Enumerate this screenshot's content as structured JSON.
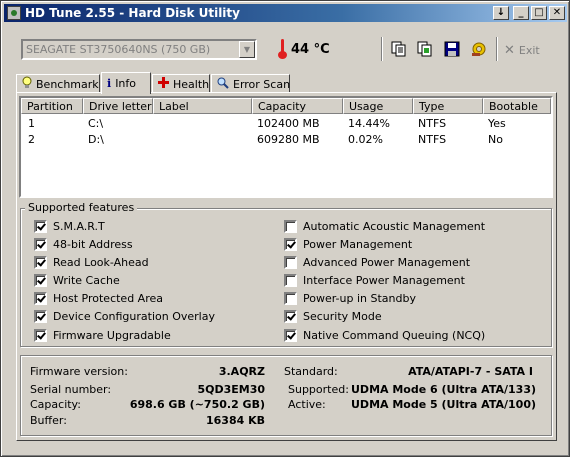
{
  "window": {
    "title": "HD Tune 2.55 - Hard Disk Utility",
    "minimize_glyph": "_",
    "restore_glyph": "□",
    "close_glyph": "✕",
    "arrow_glyph": "↓"
  },
  "toolbar": {
    "drive": "SEAGATE ST3750640NS (750 GB)",
    "temperature": "44 °C",
    "exit_label": "Exit",
    "icons": [
      "copy-info-icon",
      "copy-screenshot-icon",
      "save-icon",
      "options-icon",
      "exit-icon"
    ]
  },
  "tabs": [
    {
      "label": "Benchmark",
      "icon": "lightbulb-icon"
    },
    {
      "label": "Info",
      "icon": "info-icon",
      "active": true
    },
    {
      "label": "Health",
      "icon": "health-cross-icon"
    },
    {
      "label": "Error Scan",
      "icon": "magnifier-icon"
    }
  ],
  "partitions": {
    "columns": [
      "Partition",
      "Drive letter",
      "Label",
      "Capacity",
      "Usage",
      "Type",
      "Bootable"
    ],
    "rows": [
      [
        "1",
        "C:\\",
        "",
        "102400 MB",
        "14.44%",
        "NTFS",
        "Yes"
      ],
      [
        "2",
        "D:\\",
        "",
        "609280 MB",
        "0.02%",
        "NTFS",
        "No"
      ]
    ]
  },
  "features": {
    "title": "Supported features",
    "left": [
      {
        "label": "S.M.A.R.T",
        "checked": true
      },
      {
        "label": "48-bit Address",
        "checked": true
      },
      {
        "label": "Read Look-Ahead",
        "checked": true
      },
      {
        "label": "Write Cache",
        "checked": true
      },
      {
        "label": "Host Protected Area",
        "checked": true
      },
      {
        "label": "Device Configuration Overlay",
        "checked": true
      },
      {
        "label": "Firmware Upgradable",
        "checked": true
      }
    ],
    "right": [
      {
        "label": "Automatic Acoustic Management",
        "checked": false
      },
      {
        "label": "Power Management",
        "checked": true
      },
      {
        "label": "Advanced Power Management",
        "checked": false
      },
      {
        "label": "Interface Power Management",
        "checked": false
      },
      {
        "label": "Power-up in Standby",
        "checked": false
      },
      {
        "label": "Security Mode",
        "checked": true
      },
      {
        "label": "Native Command Queuing (NCQ)",
        "checked": true
      }
    ]
  },
  "details": {
    "firmware_label": "Firmware version:",
    "firmware": "3.AQRZ",
    "serial_label": "Serial number:",
    "serial": "5QD3EM30",
    "capacity_label": "Capacity:",
    "capacity": "698.6 GB (~750.2 GB)",
    "buffer_label": "Buffer:",
    "buffer": "16384 KB",
    "standard_label": "Standard:",
    "standard": "ATA/ATAPI-7 - SATA I",
    "supported_label": "Supported:",
    "supported": "UDMA Mode 6 (Ultra ATA/133)",
    "active_label": "Active:",
    "active": "UDMA Mode 5 (Ultra ATA/100)"
  }
}
